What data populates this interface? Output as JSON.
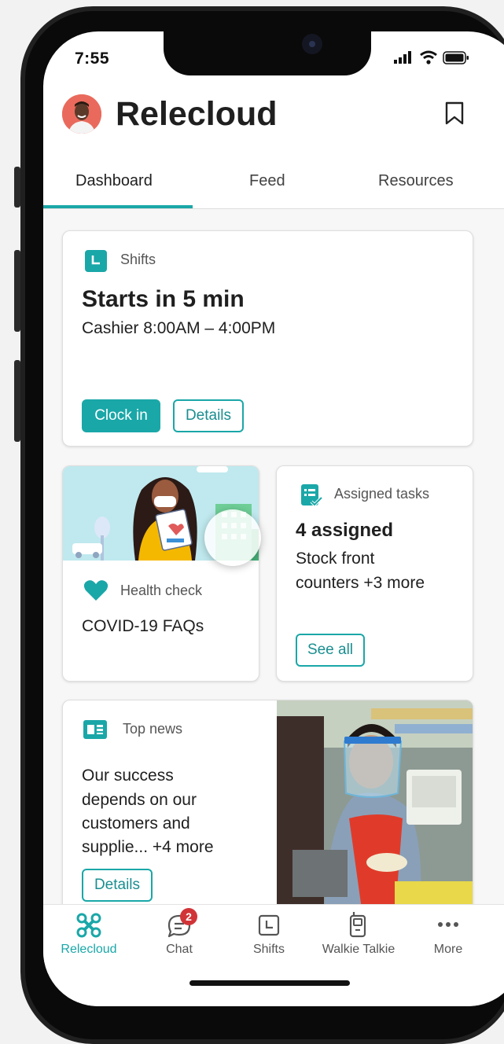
{
  "status_bar": {
    "time": "7:55"
  },
  "app": {
    "title": "Relecloud"
  },
  "tabs": [
    {
      "label": "Dashboard"
    },
    {
      "label": "Feed"
    },
    {
      "label": "Resources"
    }
  ],
  "shifts_card": {
    "label": "Shifts",
    "headline": "Starts in 5 min",
    "detail": "Cashier 8:00AM – 4:00PM",
    "clock_in_label": "Clock in",
    "details_label": "Details"
  },
  "health_card": {
    "label": "Health check",
    "title": "COVID-19 FAQs"
  },
  "tasks_card": {
    "label": "Assigned tasks",
    "headline": "4 assigned",
    "detail_line1": "Stock front",
    "detail_line2": "counters +3 more",
    "see_all_label": "See all"
  },
  "news_card": {
    "label": "Top news",
    "line1": "Our success",
    "line2": "depends on our",
    "line3": "customers and",
    "line4": "supplie... +4 more",
    "details_label": "Details"
  },
  "bottom_nav": {
    "items": [
      {
        "label": "Relecloud"
      },
      {
        "label": "Chat",
        "badge": "2"
      },
      {
        "label": "Shifts"
      },
      {
        "label": "Walkie Talkie"
      },
      {
        "label": "More"
      }
    ]
  },
  "colors": {
    "accent": "#1aa7a8",
    "badge": "#d13438",
    "text": "#1f1f1f"
  }
}
